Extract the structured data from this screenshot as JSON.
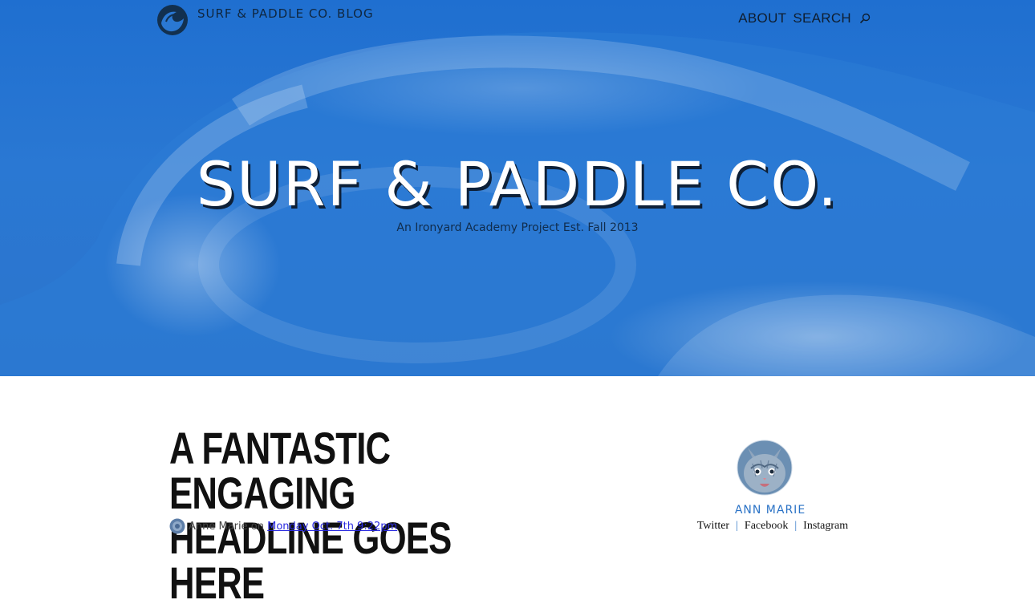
{
  "header": {
    "blog_title": "SURF & PADDLE CO. BLOG",
    "logo_icon": "wave-logo-icon",
    "nav": {
      "about": "ABOUT",
      "search": "SEARCH",
      "search_icon": "search-icon"
    }
  },
  "hero": {
    "title": "SURF & PADDLE CO.",
    "subtitle": "An Ironyard Academy Project Est. Fall 2013",
    "background_color": "#2a78d3"
  },
  "article": {
    "headline": "A FANTASTIC ENGAGING HEADLINE GOES HERE",
    "byline": {
      "author": "Anne Marie",
      "on": "on",
      "date": "Monday Oct. 7th 9:22pm"
    }
  },
  "author_card": {
    "name": "ANN MARIE",
    "social": {
      "twitter": "Twitter",
      "facebook": "Facebook",
      "instagram": "Instagram",
      "separator": "|"
    }
  },
  "colors": {
    "accent": "#2b73c6",
    "link": "#2a2ae0",
    "heading": "#111111"
  }
}
